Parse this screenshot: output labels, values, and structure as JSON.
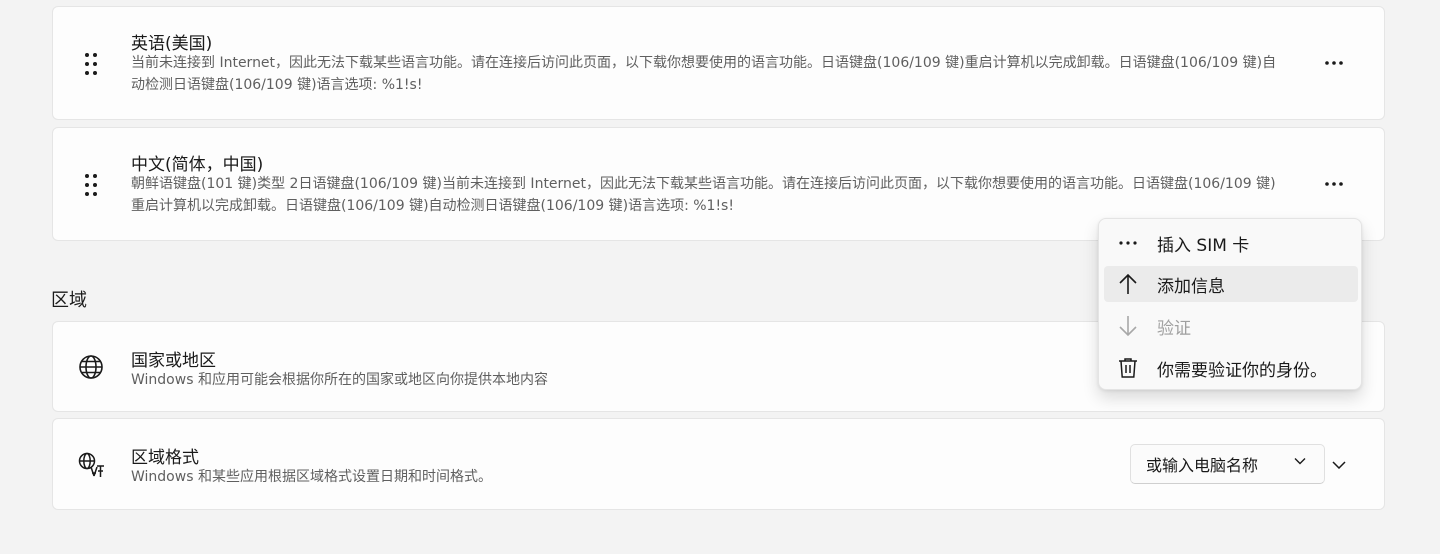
{
  "languages": [
    {
      "name": "英语(美国)",
      "description": "当前未连接到 Internet，因此无法下载某些语言功能。请在连接后访问此页面，以下载你想要使用的语言功能。日语键盘(106/109 键)重启计算机以完成卸载。日语键盘(106/109 键)自动检测日语键盘(106/109 键)语言选项: %1!s!"
    },
    {
      "name": "中文(简体，中国)",
      "description": "朝鲜语键盘(101 键)类型 2日语键盘(106/109 键)当前未连接到 Internet，因此无法下载某些语言功能。请在连接后访问此页面，以下载你想要使用的语言功能。日语键盘(106/109 键)重启计算机以完成卸载。日语键盘(106/109 键)自动检测日语键盘(106/109 键)语言选项: %1!s!"
    }
  ],
  "region_section": {
    "title": "区域",
    "country": {
      "title": "国家或地区",
      "description": "Windows 和应用可能会根据你所在的国家或地区向你提供本地内容"
    },
    "format": {
      "title": "区域格式",
      "description": "Windows 和某些应用根据区域格式设置日期和时间格式。",
      "selected_value": "或输入电脑名称"
    }
  },
  "context_menu": {
    "items": [
      {
        "label": "插入 SIM 卡",
        "icon": "more-icon",
        "disabled": false
      },
      {
        "label": "添加信息",
        "icon": "arrow-up-icon",
        "disabled": false,
        "hovered": true
      },
      {
        "label": "验证",
        "icon": "arrow-down-icon",
        "disabled": true
      },
      {
        "label": "你需要验证你的身份。",
        "icon": "trash-icon",
        "disabled": false
      }
    ]
  },
  "colors": {
    "background": "#f3f3f3",
    "card": "#fdfdfd",
    "secondary_text": "#5f5f5f",
    "disabled_text": "#a0a0a0"
  }
}
